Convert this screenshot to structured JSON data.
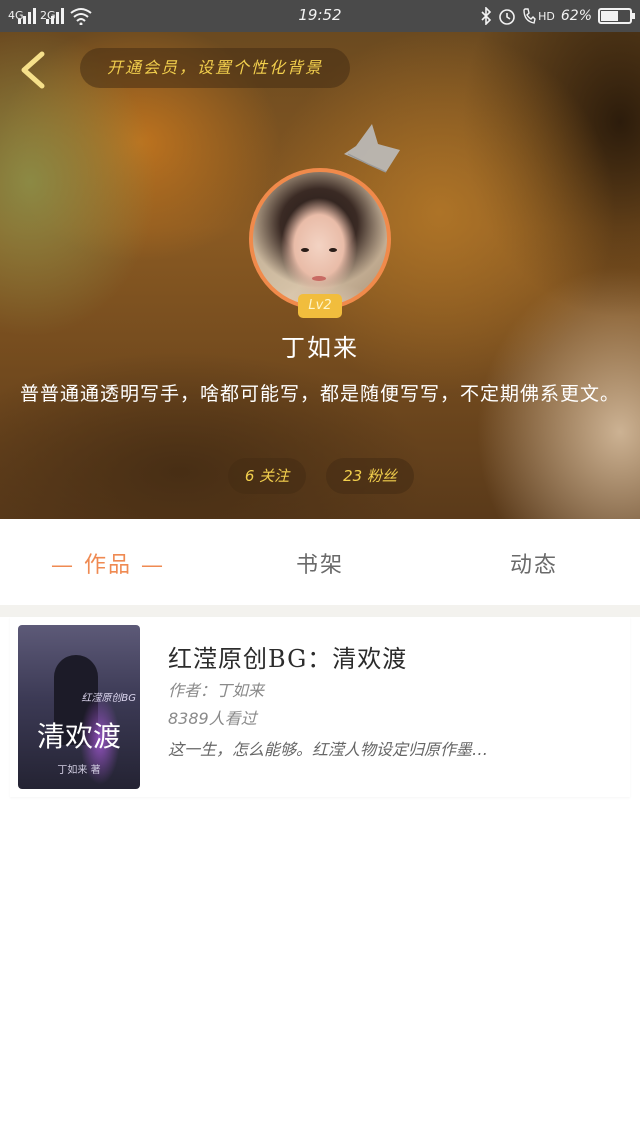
{
  "status_bar": {
    "signal_left": "4G",
    "signal_right": "2G",
    "time": "19:52",
    "hd": "HD",
    "battery": "62%",
    "battery_level": 0.62,
    "icons": [
      "signal-icon",
      "wifi-icon",
      "bluetooth-icon",
      "alarm-icon",
      "call-hd-icon",
      "battery-icon"
    ]
  },
  "header": {
    "back_icon": "chevron-left-icon",
    "vip_banner": "开通会员，设置个性化背景",
    "level": "Lv2",
    "username": "丁如来",
    "bio": "普普通通透明写手，啥都可能写，都是随便写写，不定期佛系更文。",
    "following": "6 关注",
    "followers": "23 粉丝",
    "accent": "#f2cf4d"
  },
  "tabs": {
    "items": [
      "— 作品 —",
      "书架",
      "动态"
    ],
    "active": 0,
    "active_color": "#ef8a52"
  },
  "books": [
    {
      "cover_subtitle": "红滢原创BG",
      "cover_title": "清欢渡",
      "cover_author": "丁如来 著",
      "title": "红滢原创BG：清欢渡",
      "author": "作者：丁如来",
      "views": "8389人看过",
      "description": "这一生，怎么能够。红滢人物设定归原作墨…"
    }
  ]
}
